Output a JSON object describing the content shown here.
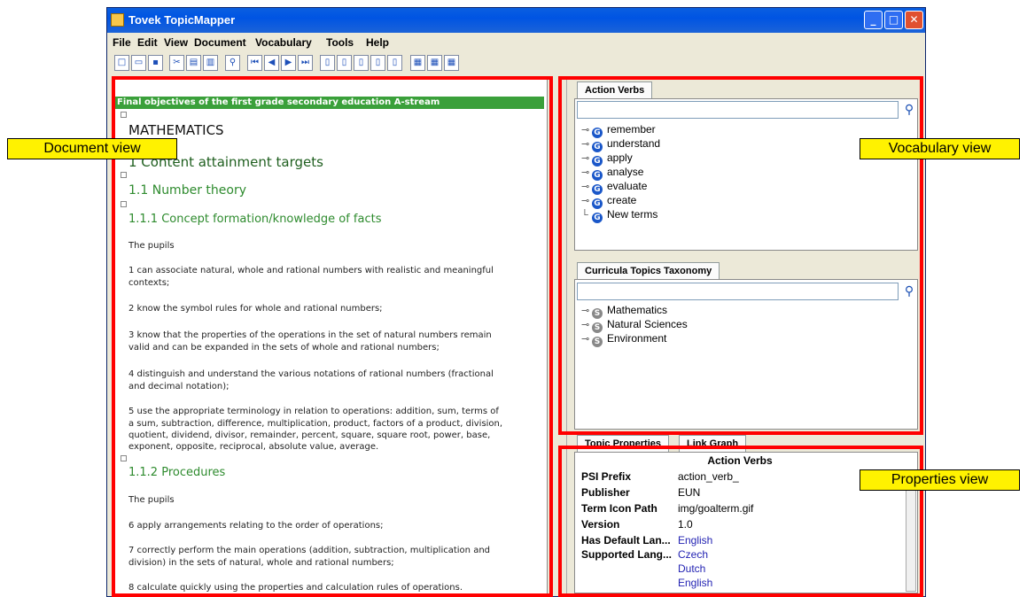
{
  "window": {
    "title": "Tovek TopicMapper",
    "controls": [
      "_",
      "□",
      "✕"
    ]
  },
  "menu": [
    "File",
    "Edit",
    "View",
    "Document",
    "Vocabulary",
    "Tools",
    "Help"
  ],
  "document": {
    "banner": "Final objectives of the first grade secondary education A-stream",
    "h_math": "MATHEMATICS",
    "h1": "1 Content attainment targets",
    "h11": "1.1 Number theory",
    "h111": "1.1.1 Concept formation/knowledge of facts",
    "pupils1": "The pupils",
    "p1a": "1 can associate natural, whole and rational numbers with realistic and meaningful",
    "p1b": "contexts;",
    "p2": "2 know the symbol rules for whole and rational numbers;",
    "p3a": "3 know that the properties of the operations in the set of natural numbers remain",
    "p3b": "valid and can be expanded in the sets of whole and rational numbers;",
    "p4a": "4 distinguish and understand the various notations of rational numbers (fractional",
    "p4b": "and decimal notation);",
    "p5a": "5 use the appropriate terminology in relation to operations: addition, sum, terms of",
    "p5b": "a sum, subtraction, difference, multiplication, product, factors of a product, division,",
    "p5c": "quotient, dividend, divisor, remainder, percent, square, square root, power, base,",
    "p5d": "exponent, opposite, reciprocal, absolute value, average.",
    "h112": "1.1.2 Procedures",
    "pupils2": "The pupils",
    "p6": "6 apply arrangements relating to the order of operations;",
    "p7a": "7 correctly perform the main operations (addition, subtraction, multiplication and",
    "p7b": "division) in the sets of natural, whole and rational numbers;",
    "p8": "8 calculate quickly using the properties and calculation rules of operations."
  },
  "vocab": {
    "tab1": "Action Verbs",
    "verbs": [
      "remember",
      "understand",
      "apply",
      "analyse",
      "evaluate",
      "create",
      "New terms"
    ],
    "tab2": "Curricula Topics Taxonomy",
    "topics": [
      "Mathematics",
      "Natural Sciences",
      "Environment"
    ]
  },
  "props": {
    "tab1": "Topic Properties",
    "tab2": "Link Graph",
    "header": "Action Verbs",
    "rows": [
      {
        "k": "PSI Prefix",
        "v": "action_verb_"
      },
      {
        "k": "Publisher",
        "v": "EUN"
      },
      {
        "k": "Term Icon Path",
        "v": "img/goalterm.gif"
      },
      {
        "k": "Version",
        "v": "1.0"
      },
      {
        "k": "Has Default Lan...",
        "v": "English"
      },
      {
        "k": "Supported Lang...",
        "v": "Czech"
      }
    ],
    "extra_langs": [
      "Dutch",
      "English"
    ]
  },
  "labels": {
    "doc": "Document view",
    "vocab": "Vocabulary view",
    "props": "Properties view"
  }
}
